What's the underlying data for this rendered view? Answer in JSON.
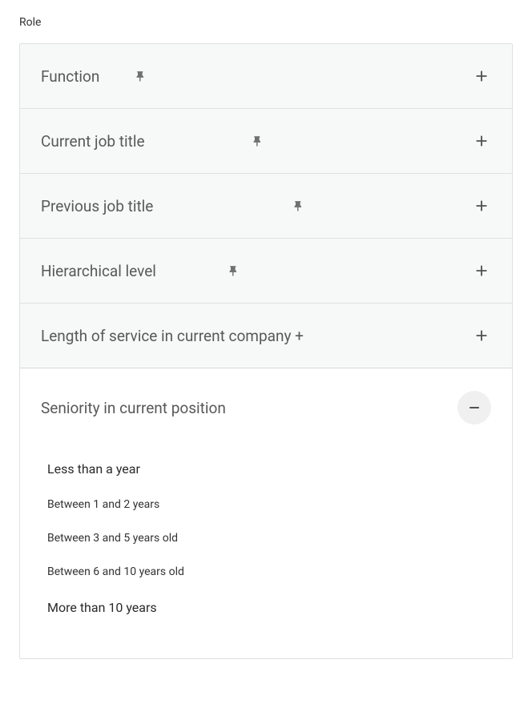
{
  "section_label": "Role",
  "items": [
    {
      "label": "Function",
      "has_pin": true,
      "expanded": false
    },
    {
      "label": "Current job title",
      "has_pin": true,
      "expanded": false
    },
    {
      "label": "Previous job title",
      "has_pin": true,
      "expanded": false
    },
    {
      "label": "Hierarchical level",
      "has_pin": true,
      "expanded": false
    },
    {
      "label": "Length of service in current company +",
      "has_pin": false,
      "expanded": false
    },
    {
      "label": "Seniority in current position",
      "has_pin": false,
      "expanded": true
    }
  ],
  "seniority_options": [
    {
      "label": "Less than a year",
      "size": "normal"
    },
    {
      "label": "Between 1 and 2 years",
      "size": "small"
    },
    {
      "label": "Between 3 and 5 years old",
      "size": "small"
    },
    {
      "label": "Between 6 and 10 years old",
      "size": "small"
    },
    {
      "label": "More than 10 years",
      "size": "normal"
    }
  ]
}
